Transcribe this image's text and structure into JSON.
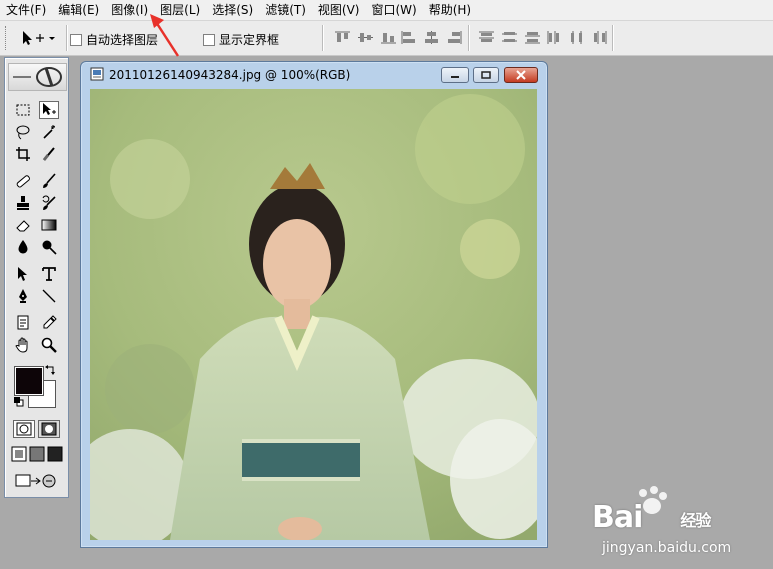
{
  "menu": [
    "文件(F)",
    "编辑(E)",
    "图像(I)",
    "图层(L)",
    "选择(S)",
    "滤镜(T)",
    "视图(V)",
    "窗口(W)",
    "帮助(H)"
  ],
  "options": {
    "auto_select_label": "自动选择图层",
    "show_bounds_label": "显示定界框"
  },
  "document": {
    "title": "20110126140943284.jpg @ 100%(RGB)"
  },
  "watermark": {
    "logo_text": "Bai",
    "logo_suffix": "经验",
    "url": "jingyan.baidu.com"
  },
  "colors": {
    "foreground": "#0d0508",
    "background": "#ffffff",
    "annotation_arrow": "#e8312a"
  },
  "icons": [
    "move-tool-icon",
    "marquee-icon",
    "lasso-icon",
    "magic-wand-icon",
    "crop-icon",
    "slice-icon",
    "healing-brush-icon",
    "brush-icon",
    "clone-stamp-icon",
    "history-brush-icon",
    "eraser-icon",
    "gradient-icon",
    "blur-icon",
    "dodge-icon",
    "path-select-icon",
    "type-icon",
    "pen-icon",
    "line-icon",
    "notes-icon",
    "eyedropper-icon",
    "hand-icon",
    "zoom-icon"
  ]
}
